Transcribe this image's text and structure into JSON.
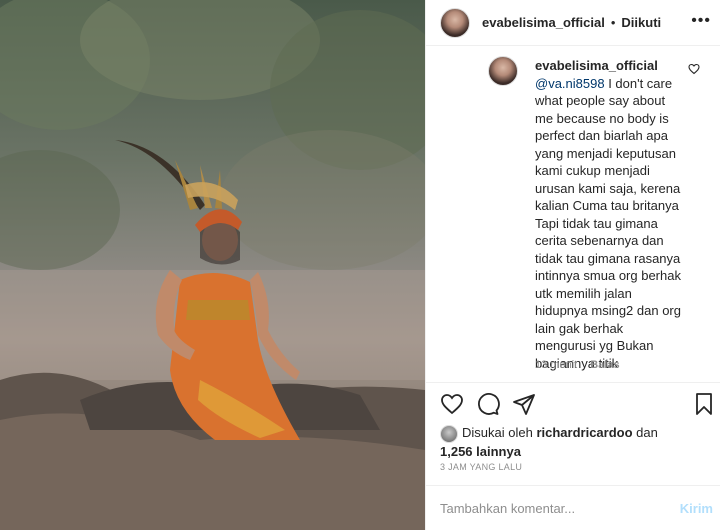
{
  "post": {
    "username": "evabelisima_official",
    "separator": "•",
    "follow_status": "Diikuti",
    "more_icon": "more-horizontal-icon"
  },
  "comment": {
    "username": "evabelisima_official",
    "mention": "@va.ni8598",
    "text": " I don't care what people say about me because no body is perfect dan biarlah apa yang menjadi keputusan kami cukup menjadi urusan kami saja, kerena kalian Cuma tau britanya Tapi tidak tau gimana cerita sebenarnya dan tidak tau gimana rasanya intinnya smua org berhak utk memilih jalan hidupnya msing2 dan org lain gak berhak mengurusi yg Bukan bagiannya titik",
    "time": "13 menit",
    "reply_label": "Balas"
  },
  "likes": {
    "prefix": "Disukai oleh",
    "user": "richardricardoo",
    "connector": "dan",
    "others": "1,256 lainnya"
  },
  "timestamp": "3 JAM YANG LALU",
  "add_comment": {
    "placeholder": "Tambahkan komentar...",
    "send_label": "Kirim"
  },
  "colors": {
    "mention": "#00376b",
    "send_disabled": "#b2dffc",
    "muted": "#8e8e8e"
  }
}
